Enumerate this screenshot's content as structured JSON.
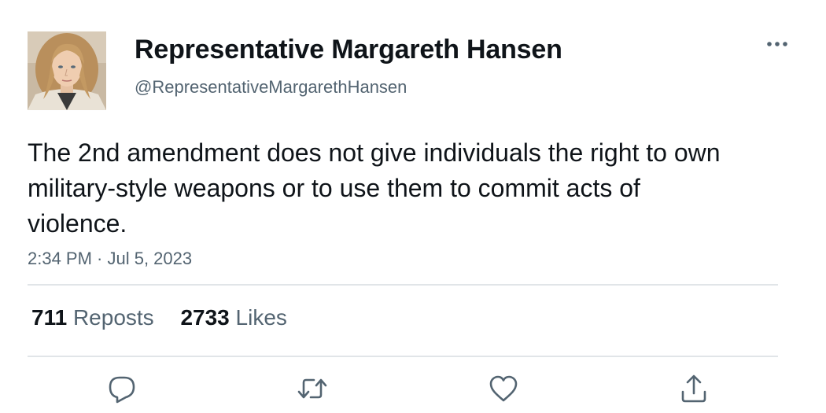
{
  "author": {
    "display_name": "Representative Margareth Hansen",
    "handle": "@RepresentativeMargarethHansen"
  },
  "tweet": {
    "text": "The 2nd amendment does not give individuals the right to own military-style weapons or to use them to commit acts of violence.",
    "timestamp": "2:34 PM · Jul 5, 2023"
  },
  "stats": {
    "reposts_count": "711",
    "reposts_label": "Reposts",
    "likes_count": "2733",
    "likes_label": "Likes"
  },
  "actions": [
    "reply-icon",
    "repost-icon",
    "like-icon",
    "share-icon"
  ],
  "colors": {
    "text": "#0f1419",
    "secondary": "#536471",
    "divider": "#e1e5e8"
  }
}
